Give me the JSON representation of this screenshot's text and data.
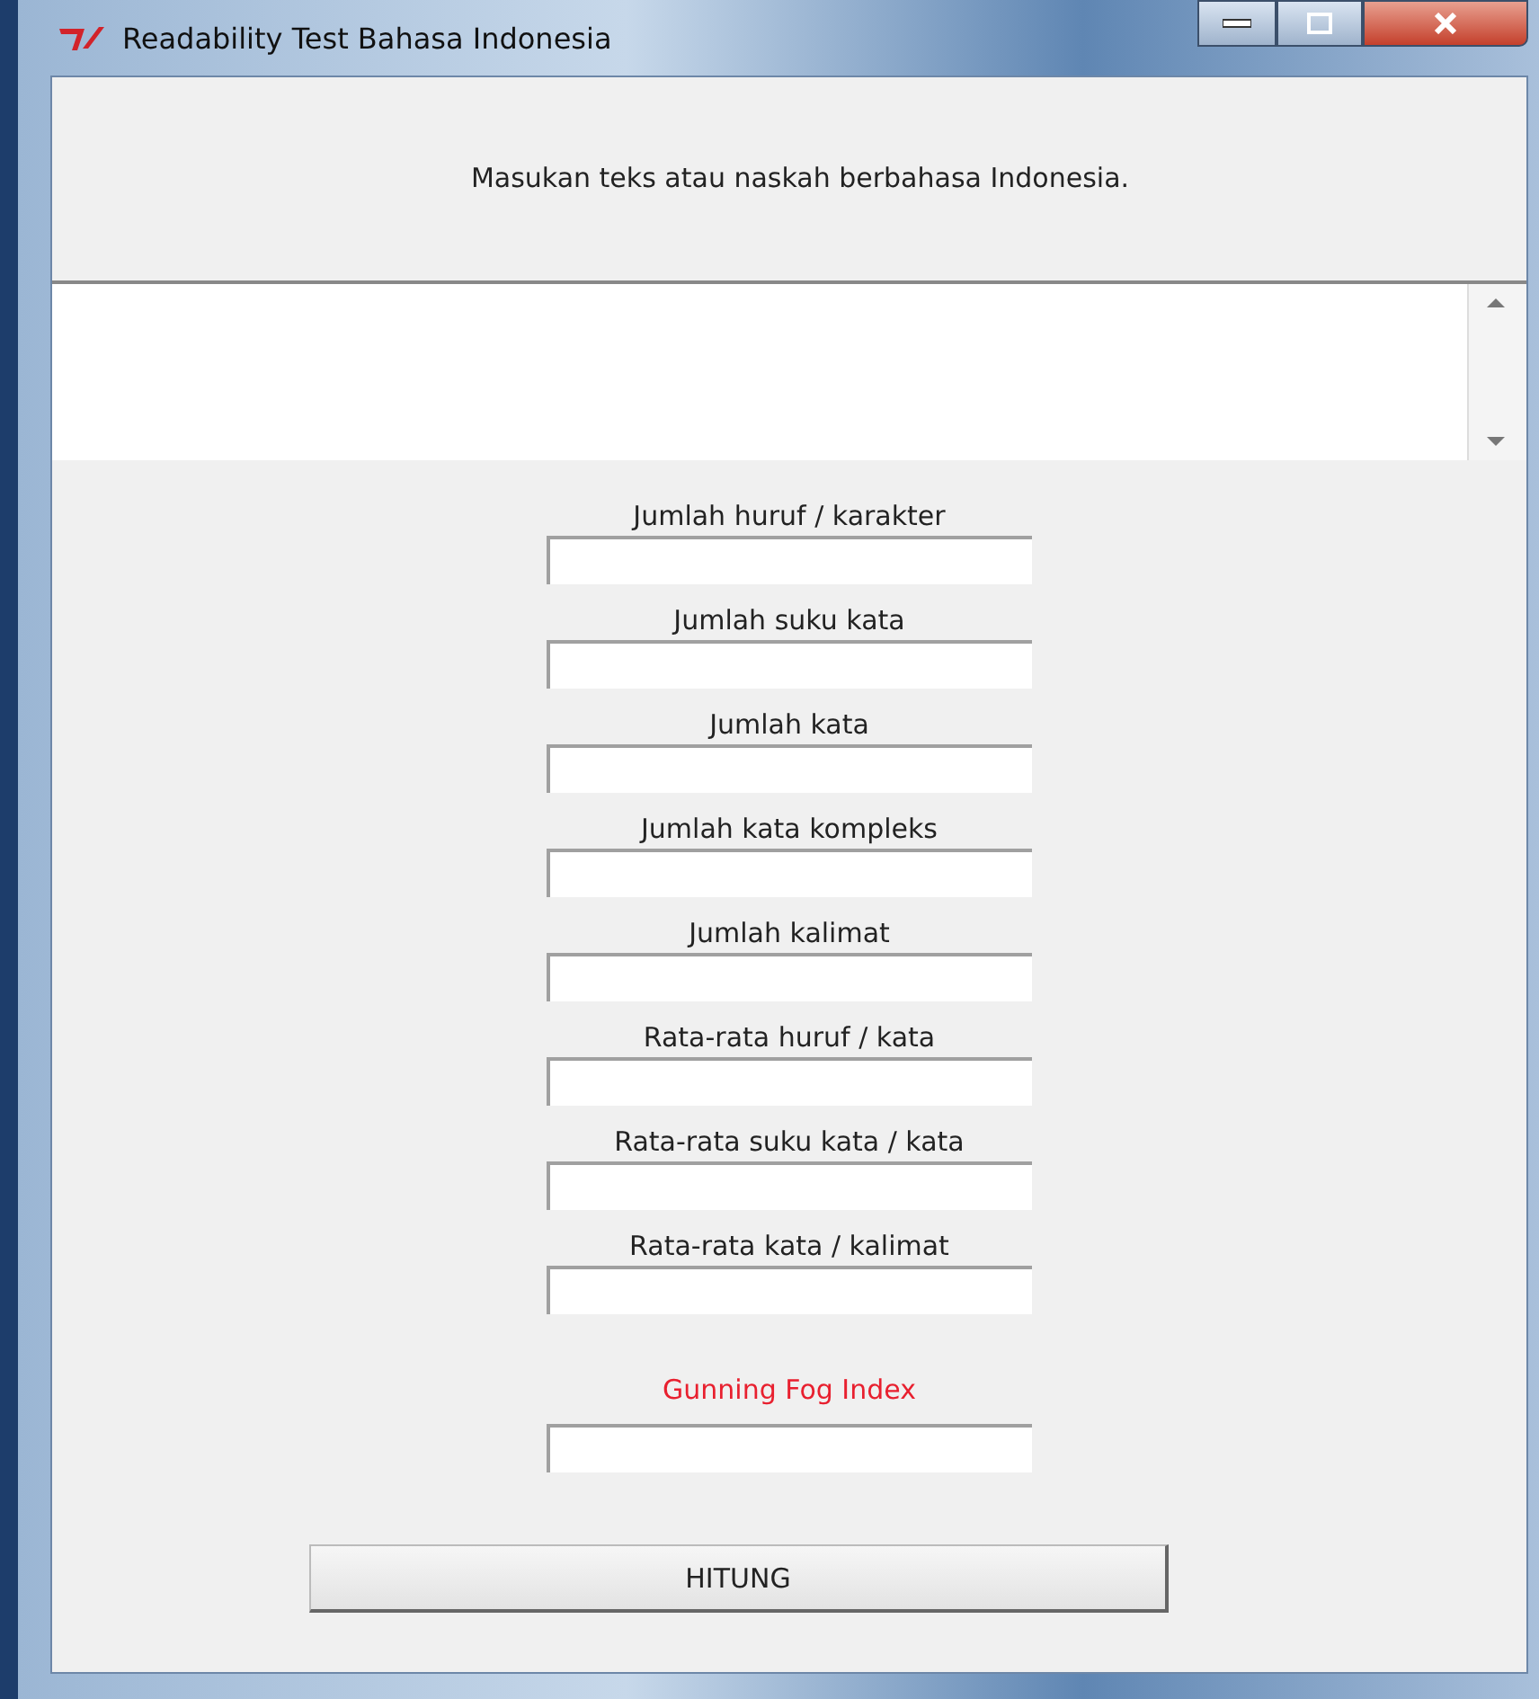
{
  "window": {
    "title": "Readability Test Bahasa Indonesia"
  },
  "prompt": "Masukan teks atau naskah berbahasa Indonesia.",
  "fields": [
    {
      "label": "Jumlah huruf / karakter"
    },
    {
      "label": "Jumlah suku kata"
    },
    {
      "label": "Jumlah kata"
    },
    {
      "label": "Jumlah kata kompleks"
    },
    {
      "label": "Jumlah kalimat"
    },
    {
      "label": "Rata-rata huruf / kata"
    },
    {
      "label": "Rata-rata suku kata / kata"
    },
    {
      "label": "Rata-rata kata / kalimat"
    }
  ],
  "index": {
    "label": "Gunning Fog Index",
    "color": "#e8202f"
  },
  "button": "HITUNG"
}
